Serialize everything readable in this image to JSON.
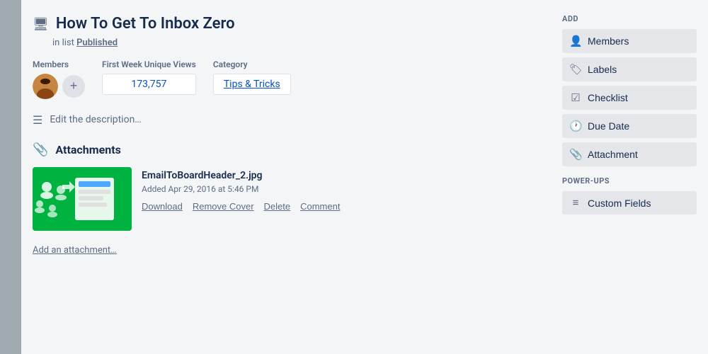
{
  "card": {
    "title": "How To Get To Inbox Zero",
    "in_list_label": "in list",
    "list_name": "Published",
    "members_label": "Members",
    "views_label": "First Week Unique Views",
    "views_value": "173,757",
    "category_label": "Category",
    "category_value": "Tips & Tricks",
    "edit_description_label": "Edit the description…"
  },
  "attachments": {
    "section_title": "Attachments",
    "items": [
      {
        "filename": "EmailToBoardHeader_2.jpg",
        "added_text": "Added Apr 29, 2016 at 5:46 PM"
      }
    ],
    "actions": {
      "download": "Download",
      "remove_cover": "Remove Cover",
      "delete": "Delete",
      "comment": "Comment"
    },
    "add_link": "Add an attachment…"
  },
  "sidebar": {
    "add_title": "Add",
    "buttons": [
      {
        "id": "members",
        "icon": "👤",
        "label": "Members"
      },
      {
        "id": "labels",
        "icon": "🏷",
        "label": "Labels"
      },
      {
        "id": "checklist",
        "icon": "☑",
        "label": "Checklist"
      },
      {
        "id": "due-date",
        "icon": "🕐",
        "label": "Due Date"
      },
      {
        "id": "attachment",
        "icon": "📎",
        "label": "Attachment"
      }
    ],
    "power_ups_title": "Power-Ups",
    "power_ups_buttons": [
      {
        "id": "custom-fields",
        "icon": "≡",
        "label": "Custom Fields"
      }
    ]
  }
}
